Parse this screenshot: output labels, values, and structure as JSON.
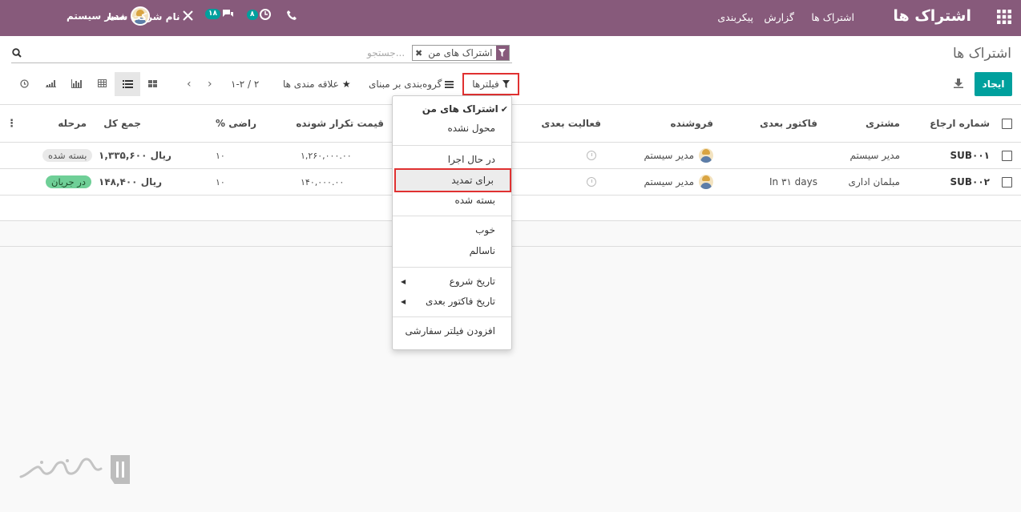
{
  "topbar": {
    "app_title": "اشتراک ها",
    "menu": [
      "اشتراک ها",
      "گزارش",
      "پیکربندی"
    ],
    "user_name": "مدیر سیستم",
    "company_name": "نام شرکت شما",
    "messages_count": "۱۸",
    "activities_count": "۸"
  },
  "control_panel": {
    "breadcrumb": "اشتراک ها",
    "search_facet": "اشتراک های من",
    "search_placeholder": "جستجو...",
    "create_label": "ایجاد",
    "filters_label": "فیلترها",
    "groupby_label": "گروه‌بندی بر مبنای",
    "favorites_label": "علاقه مندی ها",
    "pager": "۱-۲ / ۲"
  },
  "table": {
    "columns": [
      "شماره ارجاع",
      "مشتری",
      "فاکتور بعدی",
      "فروشنده",
      "فعالیت بعدی",
      "قیمت تکرار شونده",
      "% راضی",
      "جمع کل",
      "مرحله"
    ],
    "rows": [
      {
        "ref": "SUB۰۰۱",
        "customer": "مدیر سیستم",
        "next_invoice": "",
        "salesperson": "مدیر سیستم",
        "recurring": "۱,۲۶۰,۰۰۰.۰۰",
        "satisfaction": "۱۰",
        "total": "۱,۳۳۵,۶۰۰ ریال",
        "stage": "بسته شده"
      },
      {
        "ref": "SUB۰۰۲",
        "customer": "مبلمان اداری",
        "next_invoice": "In ۳۱ days",
        "salesperson": "مدیر سیستم",
        "recurring": "۱۴۰,۰۰۰.۰۰",
        "satisfaction": "۱۰",
        "total": "۱۴۸,۴۰۰ ریال",
        "stage": "در جریان"
      }
    ]
  },
  "filters_dropdown": {
    "items": [
      "اشتراک های من",
      "محول نشده",
      "در حال اجرا",
      "برای تمدید",
      "بسته شده",
      "خوب",
      "ناسالم",
      "تاریخ شروع",
      "تاریخ فاکتور بعدی",
      "افزودن فیلتر سفارشی"
    ]
  },
  "colors": {
    "brand": "#875a7b",
    "accent": "#00a09d",
    "highlight": "#e03131"
  }
}
